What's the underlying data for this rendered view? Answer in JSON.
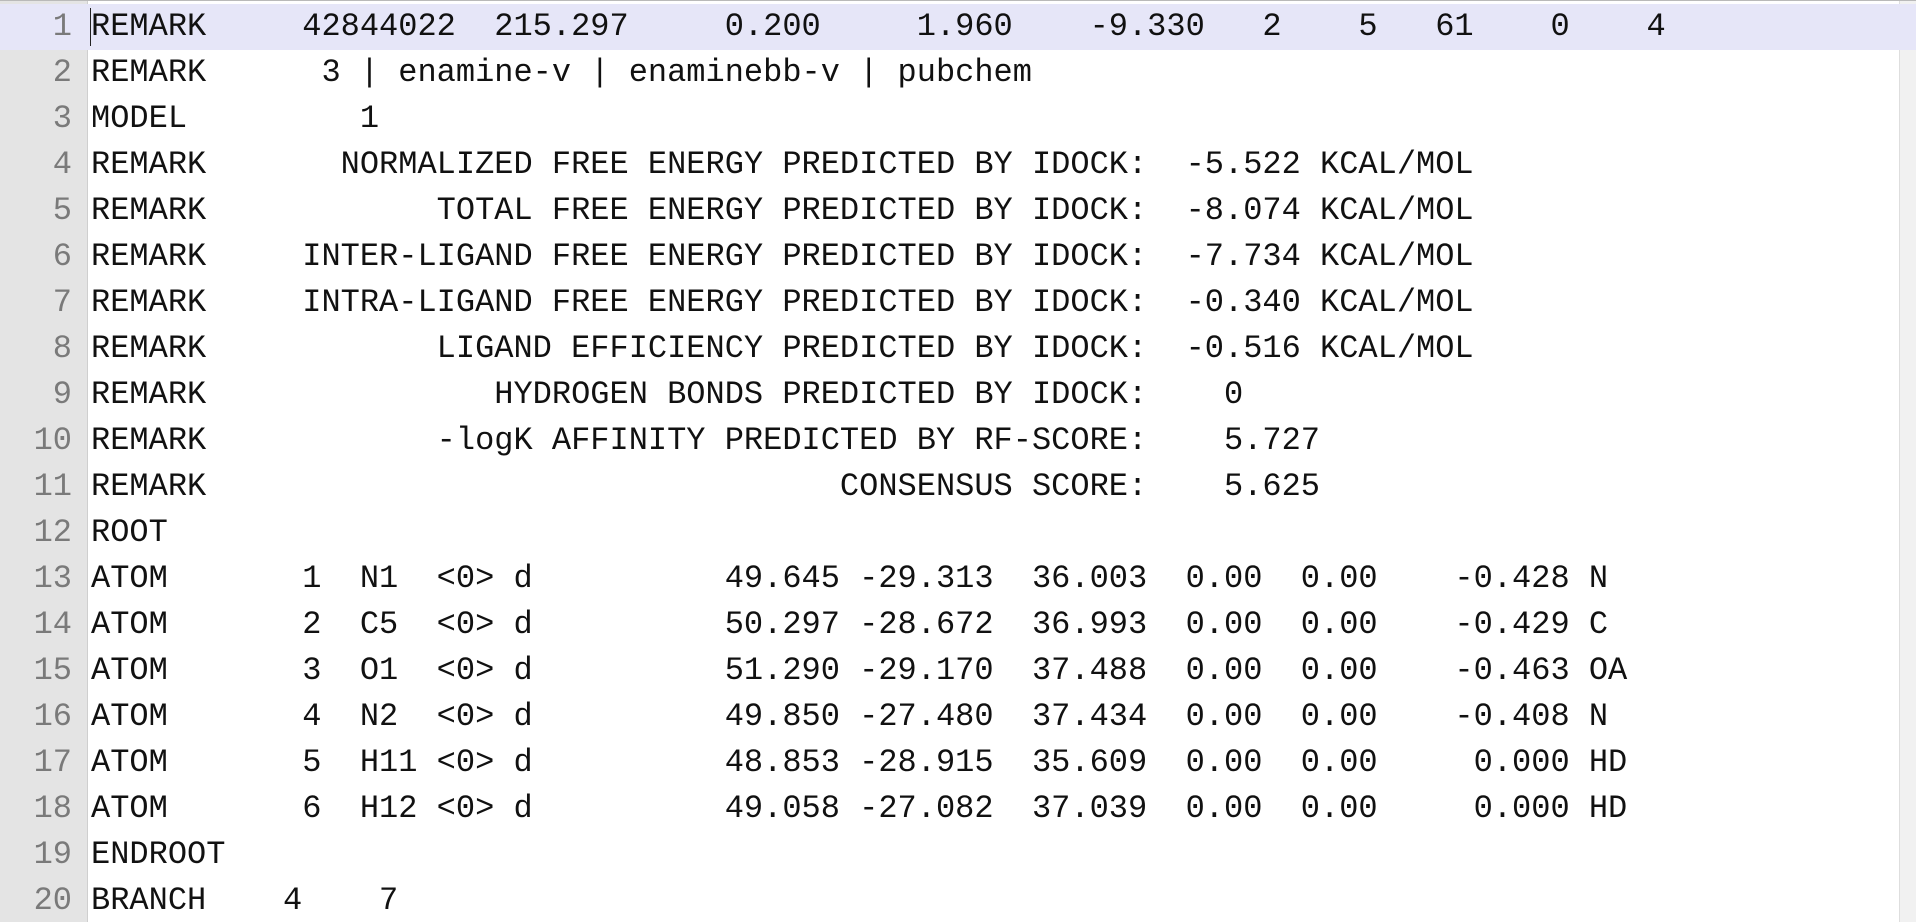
{
  "editor": {
    "lines": [
      {
        "num": "1",
        "text": "REMARK     42844022  215.297     0.200     1.960    -9.330   2    5   61    0    4"
      },
      {
        "num": "2",
        "text": "REMARK      3 | enamine-v | enaminebb-v | pubchem"
      },
      {
        "num": "3",
        "text": "MODEL         1"
      },
      {
        "num": "4",
        "text": "REMARK       NORMALIZED FREE ENERGY PREDICTED BY IDOCK:  -5.522 KCAL/MOL"
      },
      {
        "num": "5",
        "text": "REMARK            TOTAL FREE ENERGY PREDICTED BY IDOCK:  -8.074 KCAL/MOL"
      },
      {
        "num": "6",
        "text": "REMARK     INTER-LIGAND FREE ENERGY PREDICTED BY IDOCK:  -7.734 KCAL/MOL"
      },
      {
        "num": "7",
        "text": "REMARK     INTRA-LIGAND FREE ENERGY PREDICTED BY IDOCK:  -0.340 KCAL/MOL"
      },
      {
        "num": "8",
        "text": "REMARK            LIGAND EFFICIENCY PREDICTED BY IDOCK:  -0.516 KCAL/MOL"
      },
      {
        "num": "9",
        "text": "REMARK               HYDROGEN BONDS PREDICTED BY IDOCK:    0"
      },
      {
        "num": "10",
        "text": "REMARK            -logK AFFINITY PREDICTED BY RF-SCORE:    5.727"
      },
      {
        "num": "11",
        "text": "REMARK                                 CONSENSUS SCORE:    5.625"
      },
      {
        "num": "12",
        "text": "ROOT"
      },
      {
        "num": "13",
        "text": "ATOM       1  N1  <0> d          49.645 -29.313  36.003  0.00  0.00    -0.428 N"
      },
      {
        "num": "14",
        "text": "ATOM       2  C5  <0> d          50.297 -28.672  36.993  0.00  0.00    -0.429 C"
      },
      {
        "num": "15",
        "text": "ATOM       3  O1  <0> d          51.290 -29.170  37.488  0.00  0.00    -0.463 OA"
      },
      {
        "num": "16",
        "text": "ATOM       4  N2  <0> d          49.850 -27.480  37.434  0.00  0.00    -0.408 N"
      },
      {
        "num": "17",
        "text": "ATOM       5  H11 <0> d          48.853 -28.915  35.609  0.00  0.00     0.000 HD"
      },
      {
        "num": "18",
        "text": "ATOM       6  H12 <0> d          49.058 -27.082  37.039  0.00  0.00     0.000 HD"
      },
      {
        "num": "19",
        "text": "ENDROOT"
      },
      {
        "num": "20",
        "text": "BRANCH    4    7"
      }
    ]
  },
  "colors": {
    "current_line_highlight": "#e6e6f8",
    "gutter_background": "#e4e4e4",
    "line_number_text": "#7a7a7a",
    "text": "#111111"
  }
}
